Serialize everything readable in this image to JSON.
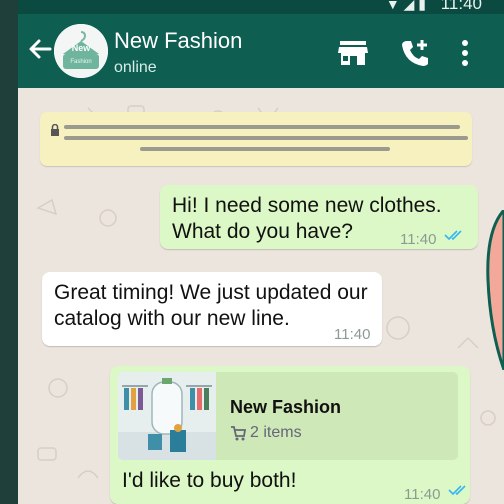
{
  "status": {
    "time": "11:40"
  },
  "header": {
    "contact_name": "New Fashion",
    "status": "online",
    "avatar_text": "New Fashion"
  },
  "messages": [
    {
      "direction": "outgoing",
      "text": "Hi! I need some new clothes.\nWhat do you have?",
      "time": "11:40",
      "read": true
    },
    {
      "direction": "incoming",
      "text": "Great timing! We just updated our\ncatalog with our new line.",
      "time": "11:40"
    },
    {
      "direction": "outgoing",
      "catalog": {
        "name": "New Fashion",
        "items": "2 items"
      },
      "text": "I'd like to buy both!",
      "time": "11:40",
      "read": true
    }
  ],
  "colors": {
    "header": "#0e5e52",
    "outgoing_bubble": "#dcf8c6",
    "incoming_bubble": "#ffffff",
    "read_ticks": "#34b7f1",
    "wallpaper": "#ece5dd"
  },
  "icons": [
    "back-arrow-icon",
    "store-icon",
    "add-call-icon",
    "more-vert-icon",
    "lock-icon",
    "double-check-icon",
    "cart-icon"
  ]
}
